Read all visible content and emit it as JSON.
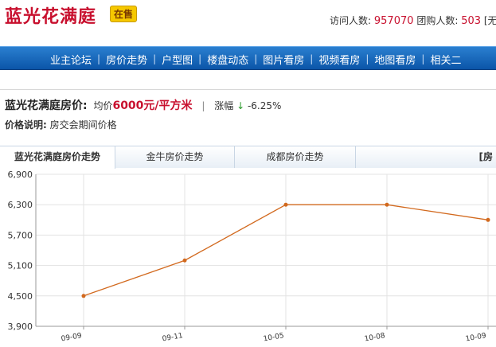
{
  "header": {
    "title": "蓝光花满庭",
    "badge": "在售",
    "visits_label": "访问人数:",
    "visits_value": "957070",
    "groupbuy_label": "团购人数:",
    "groupbuy_value": "503",
    "groupbuy_tail": "[无"
  },
  "nav": {
    "items": [
      "业主论坛",
      "房价走势",
      "户型图",
      "楼盘动态",
      "图片看房",
      "视频看房",
      "地图看房",
      "相关二"
    ]
  },
  "price": {
    "label": "蓝光花满庭房价:",
    "avg_prefix": "均价",
    "avg_value": "6000元/平方米",
    "change_label": "涨幅",
    "change_arrow": "↓",
    "change_value": "-6.25%"
  },
  "desc": {
    "label": "价格说明:",
    "text": "房交会期间价格"
  },
  "tabs": [
    "蓝光花满庭房价走势",
    "金牛房价走势",
    "成都房价走势",
    "[房"
  ],
  "colors": {
    "line": "#d2691e",
    "nav": "#0b55a8",
    "accent": "#c8102e"
  },
  "chart_data": {
    "type": "line",
    "categories": [
      "09-09",
      "09-11",
      "10-05",
      "10-08",
      "10-09"
    ],
    "values": [
      4500,
      5200,
      6300,
      6300,
      6000
    ],
    "yticks": [
      "3,900",
      "4,500",
      "5,100",
      "5,700",
      "6,300",
      "6,900"
    ],
    "ylim": [
      3900,
      6900
    ],
    "grid": true
  }
}
